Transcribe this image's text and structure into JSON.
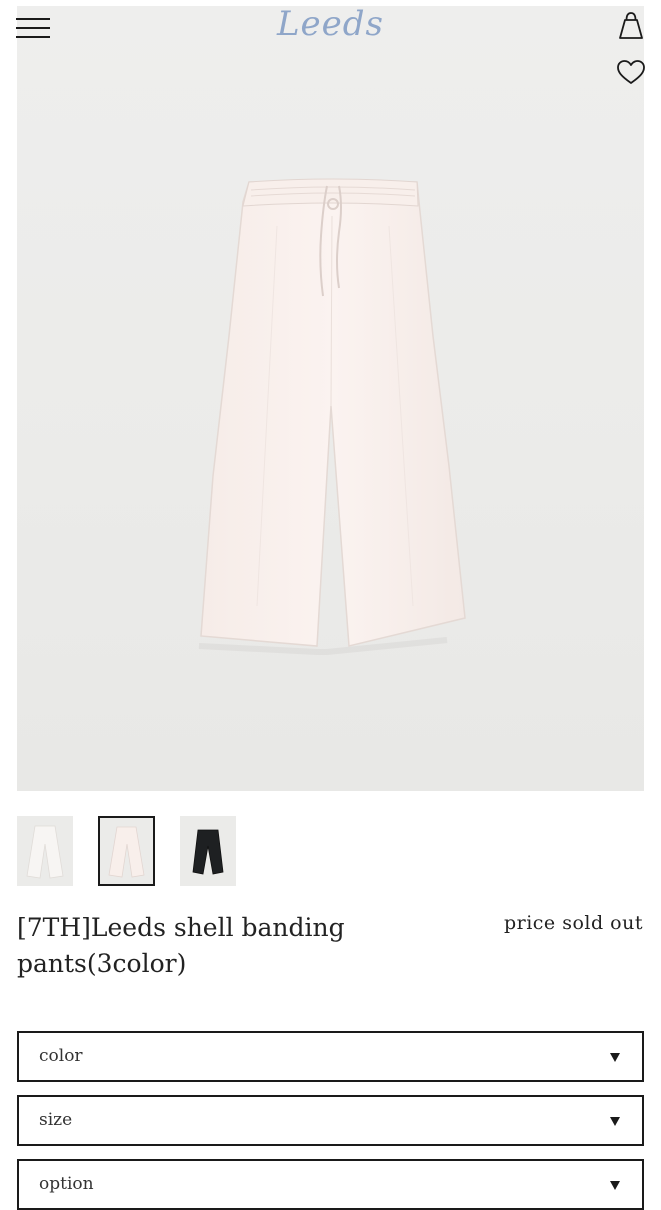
{
  "header": {
    "logo_text": "Leeds",
    "logo_color": "#8fa6c9",
    "icons": [
      "hamburger-menu-icon",
      "shopping-bag-icon",
      "heart-icon"
    ]
  },
  "product": {
    "main_image": "cream-wide-leg-banding-pants",
    "thumbnails": [
      "white-pants-thumbnail",
      "cream-pants-thumbnail",
      "black-pants-thumbnail"
    ],
    "selected_thumbnail": 2,
    "title": "[7TH]Leeds shell banding pants(3color)",
    "price_text": "price sold out"
  },
  "options": {
    "color_label": "color",
    "size_label": "size",
    "option_label": "option"
  }
}
